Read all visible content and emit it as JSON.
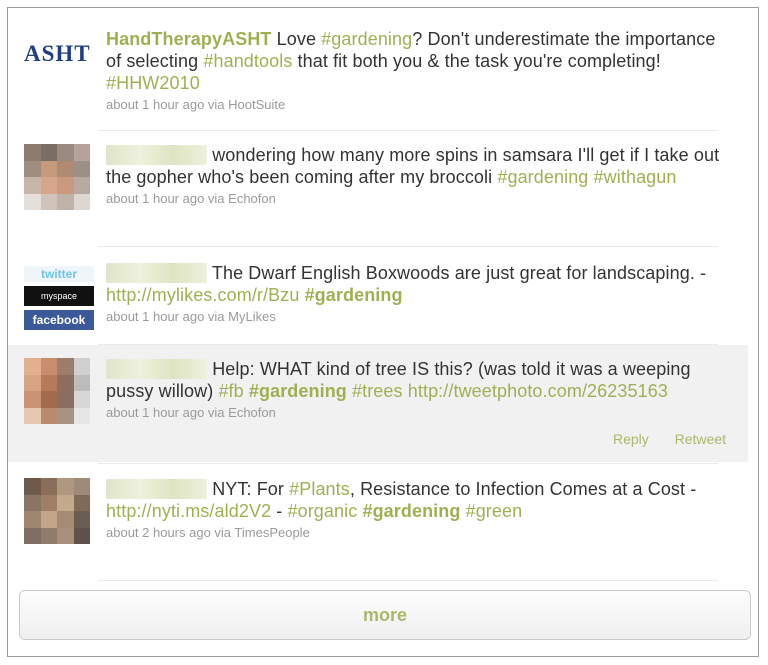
{
  "tweets": [
    {
      "user": "HandTherapyASHT",
      "avatar_text": "ASHT",
      "text_parts": [
        {
          "t": " Love "
        },
        {
          "tag": "#gardening"
        },
        {
          "t": "? Don't underestimate the importance of selecting "
        },
        {
          "tag": "#handtools"
        },
        {
          "t": " that fit both you & the task you're completing! "
        },
        {
          "tag": "#HHW2010"
        }
      ],
      "meta": "about 1 hour ago via HootSuite"
    },
    {
      "user": "",
      "text_parts": [
        {
          "t": " wondering how many more spins in samsara I'll get if I take out the gopher who's been coming after my broccoli "
        },
        {
          "tag": "#gardening"
        },
        {
          "t": " "
        },
        {
          "tag": "#withagun"
        }
      ],
      "meta": "about 1 hour ago via Echofon"
    },
    {
      "user": "",
      "avatar_labels": [
        "twitter",
        "myspace",
        "facebook"
      ],
      "text_parts": [
        {
          "t": " The Dwarf English Boxwoods are just great for landscaping. - "
        },
        {
          "link": "http://mylikes.com/r/Bzu"
        },
        {
          "t": " "
        },
        {
          "tagb": "#gardening"
        }
      ],
      "meta": "about 1 hour ago via MyLikes"
    },
    {
      "user": "",
      "text_parts": [
        {
          "t": " Help: WHAT kind of tree IS this? (was told it was a weeping pussy willow) "
        },
        {
          "tag": "#fb"
        },
        {
          "t": " "
        },
        {
          "tagb": "#gardening"
        },
        {
          "t": " "
        },
        {
          "tag": "#trees"
        },
        {
          "t": " "
        },
        {
          "link": "http://tweetphoto.com/26235163"
        }
      ],
      "meta": "about 1 hour ago via Echofon",
      "actions": [
        "Reply",
        "Retweet"
      ]
    },
    {
      "user": "",
      "text_parts": [
        {
          "t": " NYT: For "
        },
        {
          "tag": "#Plants"
        },
        {
          "t": ", Resistance to Infection Comes at a Cost - "
        },
        {
          "link": "http://nyti.ms/ald2V2"
        },
        {
          "t": " - "
        },
        {
          "tag": "#organic"
        },
        {
          "t": " "
        },
        {
          "tagb": "#gardening"
        },
        {
          "t": " "
        },
        {
          "tag": "#green"
        }
      ],
      "meta": "about 2 hours ago via TimesPeople"
    }
  ],
  "more_label": "more",
  "colors": {
    "accent": "#9fb053",
    "text": "#333333",
    "meta": "#9a9a9a",
    "highlight": "#f1f1f1"
  },
  "pixel_avatars": [
    [
      "#8c7a6e",
      "#7a6d66",
      "#9a8a80",
      "#b3a39a",
      "#a08d80",
      "#c79a7e",
      "#b08b73",
      "#9c8f88",
      "#c9b6aa",
      "#d6a58a",
      "#c99a80",
      "#b8aaa2",
      "#e6e0dc",
      "#cfc3ba",
      "#bfb2a9",
      "#ddd6d1"
    ],
    [
      "#e2b08e",
      "#c88d6c",
      "#9c7d6c",
      "#d0d0d0",
      "#d8a584",
      "#b77a58",
      "#8d6d5f",
      "#bcbcbc",
      "#c99276",
      "#a46a4e",
      "#8a6e62",
      "#d7d7d7",
      "#e8c8b0",
      "#b88a6e",
      "#a79385",
      "#e6e6e6"
    ],
    [
      "#6e5a4c",
      "#8a6e5a",
      "#b0987e",
      "#9d8b7a",
      "#8a7565",
      "#a07d64",
      "#c4a98c",
      "#7f6a5a",
      "#9e8670",
      "#c2a487",
      "#a68b74",
      "#6b5d52",
      "#7e6e63",
      "#8f7c6d",
      "#a6907d",
      "#5d524b"
    ]
  ]
}
